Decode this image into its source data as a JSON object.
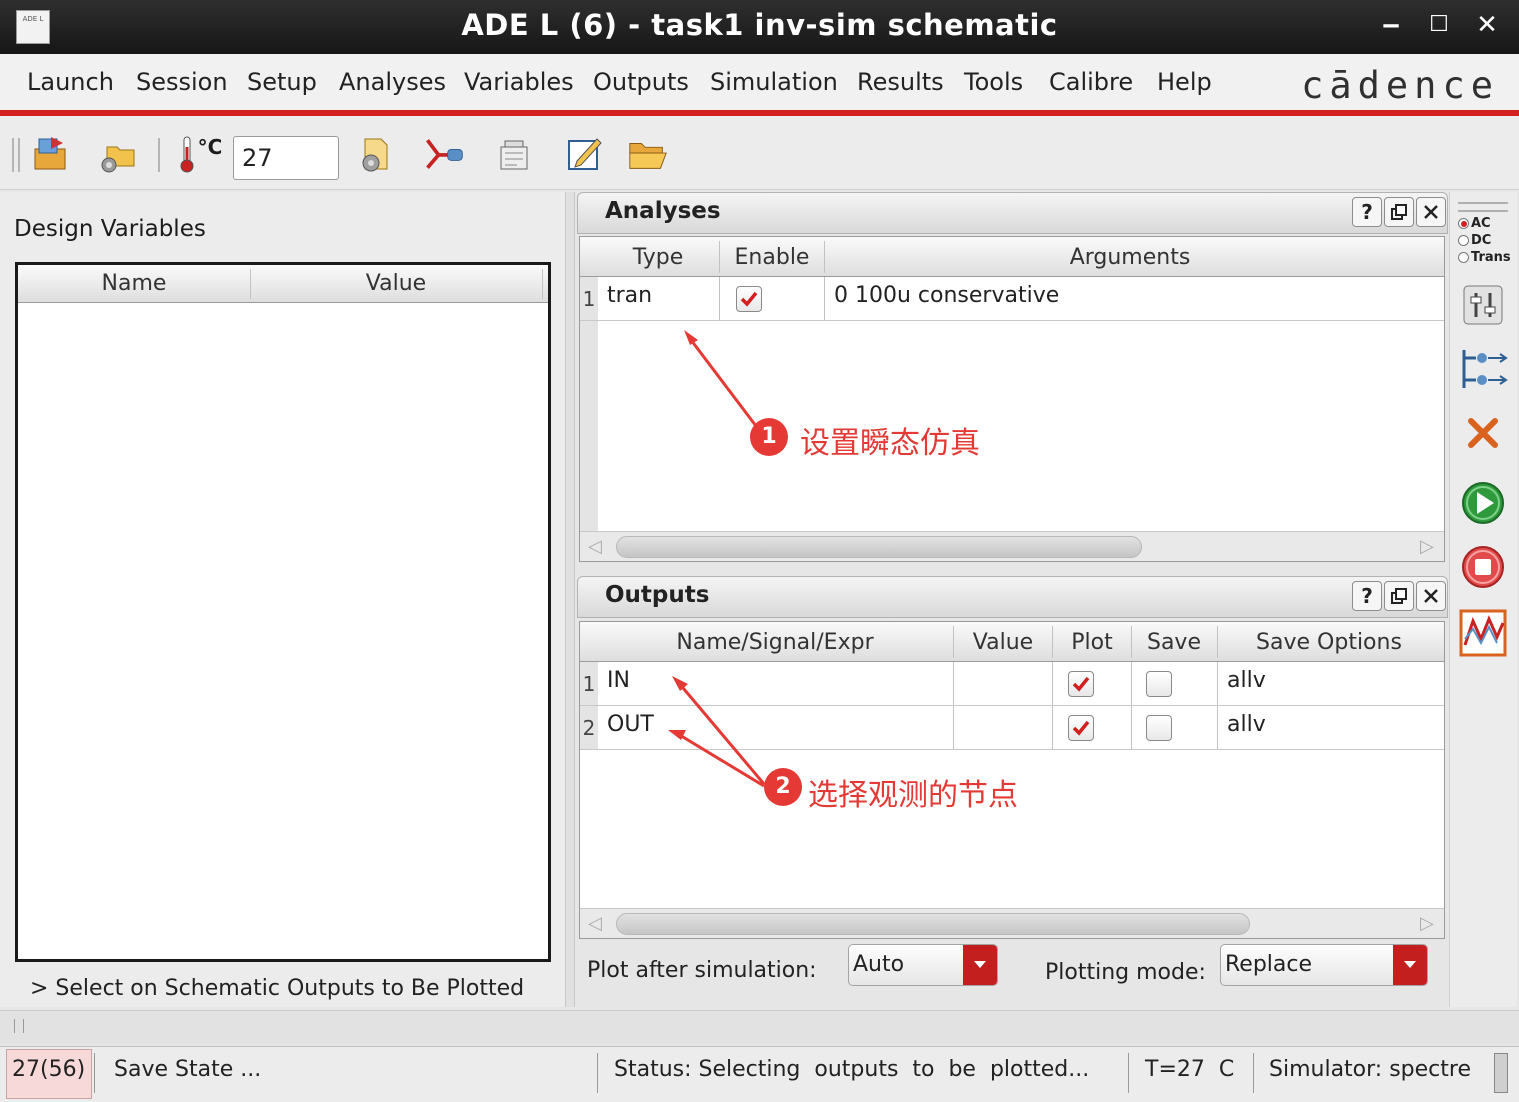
{
  "window": {
    "title": "ADE L (6) - task1 inv-sim schematic",
    "app_icon_text": "ADE L",
    "min_glyph": "‒",
    "max_glyph": "☐",
    "close_glyph": "✕"
  },
  "menu": {
    "items": [
      "Launch",
      "Session",
      "Setup",
      "Analyses",
      "Variables",
      "Outputs",
      "Simulation",
      "Results",
      "Tools",
      "Calibre",
      "Help"
    ],
    "brand": "cādence"
  },
  "toolbar": {
    "temp_unit": "°C",
    "temperature": "27"
  },
  "design_variables": {
    "title": "Design Variables",
    "columns": [
      "Name",
      "Value"
    ],
    "rows": [],
    "hint": "> Select on Schematic Outputs to Be Plotted"
  },
  "analyses": {
    "title": "Analyses",
    "help_btn": "?",
    "columns": [
      "Type",
      "Enable",
      "Arguments"
    ],
    "rows": [
      {
        "num": "1",
        "type": "tran",
        "enabled": true,
        "arguments": "0 100u conservative"
      }
    ]
  },
  "outputs": {
    "title": "Outputs",
    "help_btn": "?",
    "columns": [
      "Name/Signal/Expr",
      "Value",
      "Plot",
      "Save",
      "Save Options"
    ],
    "rows": [
      {
        "num": "1",
        "name": "IN",
        "value": "",
        "plot": true,
        "save": false,
        "save_options": "allv"
      },
      {
        "num": "2",
        "name": "OUT",
        "value": "",
        "plot": true,
        "save": false,
        "save_options": "allv"
      }
    ]
  },
  "plot_controls": {
    "plot_after_label": "Plot after simulation:",
    "plot_after_value": "Auto",
    "plotting_mode_label": "Plotting mode:",
    "plotting_mode_value": "Replace"
  },
  "annotations": [
    {
      "num": "1",
      "text": "设置瞬态仿真"
    },
    {
      "num": "2",
      "text": "选择观测的节点"
    }
  ],
  "right_strip": {
    "analysis_options": [
      {
        "label": "AC",
        "selected": true
      },
      {
        "label": "DC",
        "selected": false
      },
      {
        "label": "Trans",
        "selected": false
      }
    ],
    "icons": [
      "tune-icon",
      "netlist-icon",
      "cancel-icon",
      "run-icon",
      "stop-icon",
      "waveform-icon"
    ]
  },
  "status": {
    "counter": "27(56)",
    "save_state": "Save State ...",
    "status_text": "Status: Selecting  outputs  to  be  plotted...",
    "temp_text": "T=27  C",
    "simulator": "Simulator: spectre"
  },
  "colors": {
    "accent_red": "#d21f1f",
    "annotation_red": "#e53935",
    "run_green": "#2e9a3c"
  }
}
